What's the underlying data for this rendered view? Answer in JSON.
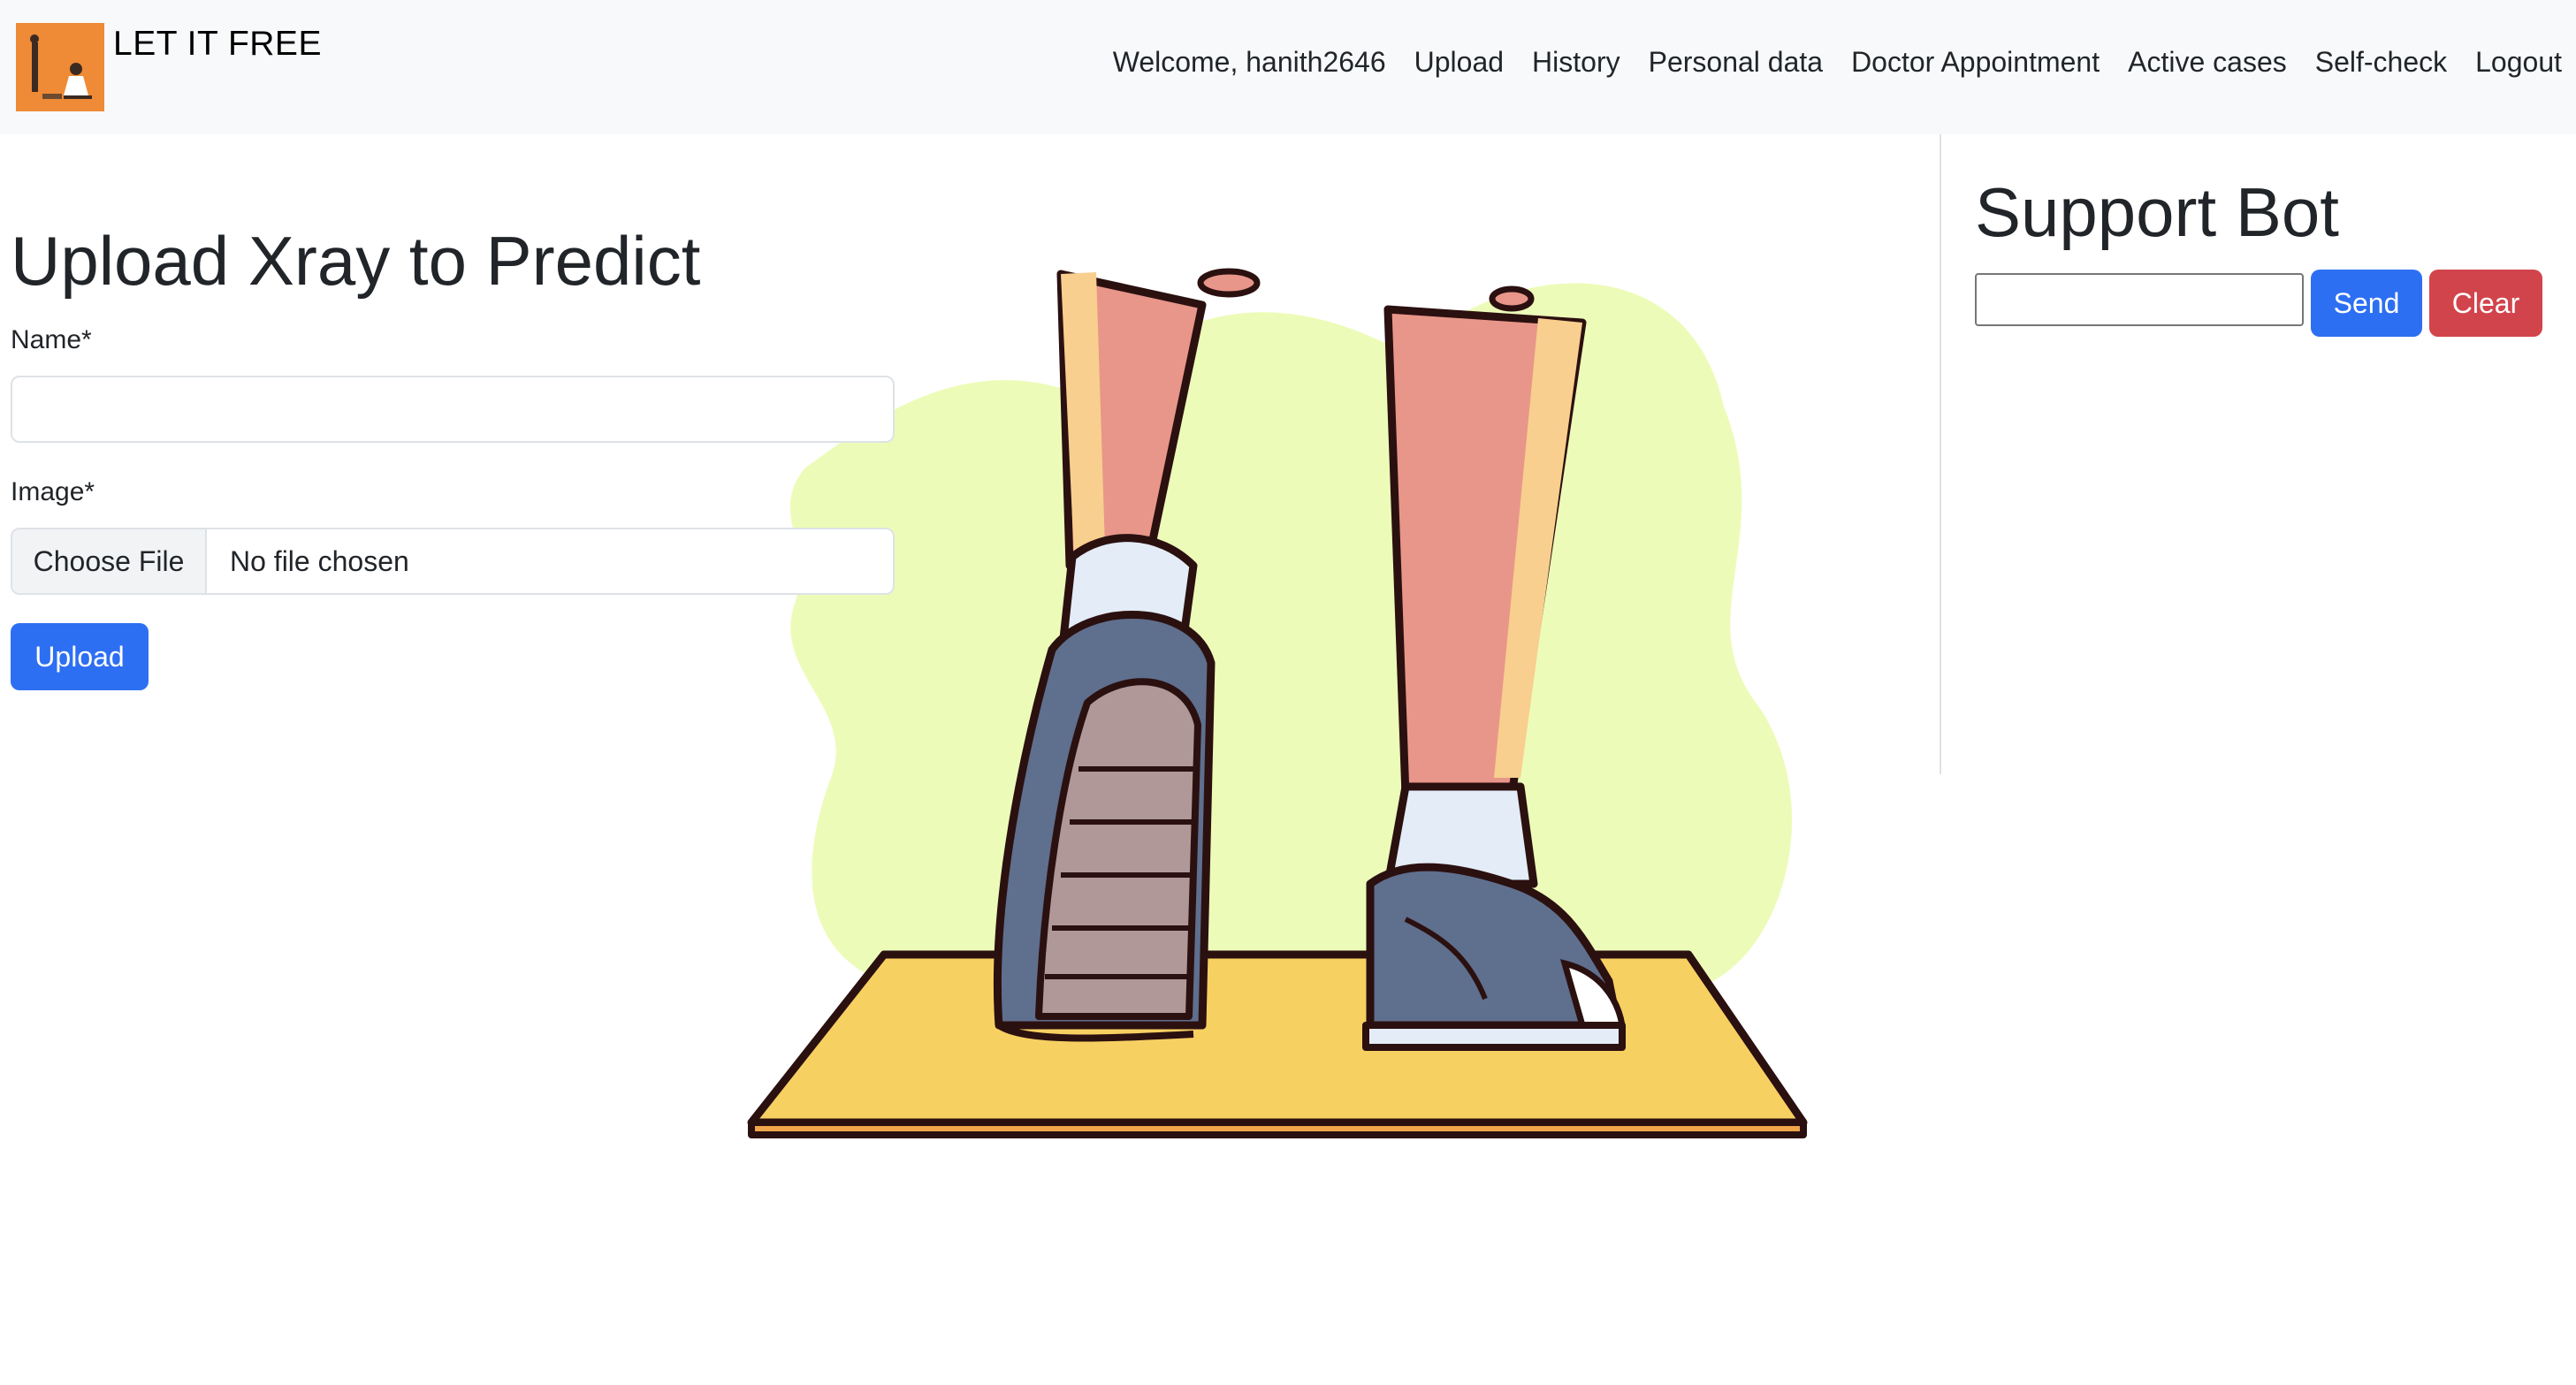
{
  "brand": {
    "name": "LET IT FREE",
    "logo_icon": "person-kneeling-logo-icon"
  },
  "nav": {
    "welcome": "Welcome, hanith2646",
    "items": [
      "Upload",
      "History",
      "Personal data",
      "Doctor Appointment",
      "Active cases",
      "Self-check",
      "Logout"
    ]
  },
  "form": {
    "title": "Upload Xray to Predict",
    "name_label": "Name*",
    "name_value": "",
    "image_label": "Image*",
    "file_button": "Choose File",
    "file_status": "No file chosen",
    "submit_label": "Upload"
  },
  "support_bot": {
    "title": "Support Bot",
    "input_value": "",
    "send_label": "Send",
    "clear_label": "Clear"
  },
  "illustration": {
    "icon": "feet-walking-illustration"
  },
  "colors": {
    "navbar_bg": "#f8f9fa",
    "primary": "#2d6ff2",
    "danger": "#d2444c",
    "logo_bg": "#ef8a36",
    "blob": "#edfbb8",
    "mat": "#f7d062",
    "leg": "#e8968a",
    "shoe": "#5f6f8e"
  }
}
